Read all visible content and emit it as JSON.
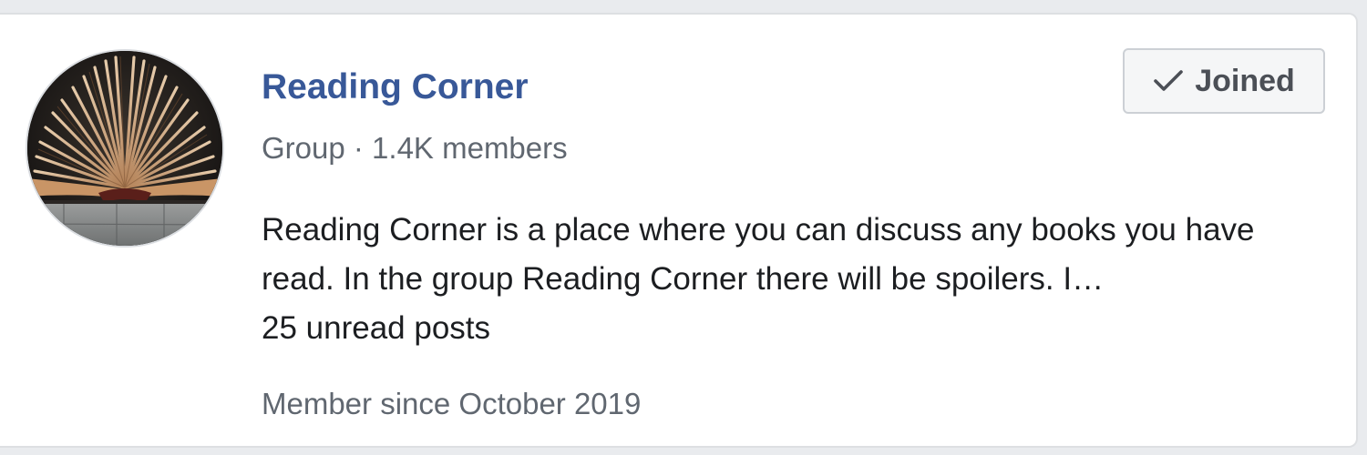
{
  "group": {
    "name": "Reading Corner",
    "meta": "Group · 1.4K members",
    "description": "Reading Corner is a place where you can discuss any books you have read. In the group Reading Corner there will be spoilers. I…",
    "unread": "25 unread posts",
    "member_since": "Member since October 2019",
    "avatar_icon": "open-book-photo"
  },
  "actions": {
    "joined_label": "Joined",
    "joined_icon": "check-icon"
  },
  "colors": {
    "link": "#385898",
    "secondary_text": "#606770",
    "primary_text": "#1c1e21",
    "button_bg": "#f5f6f7"
  }
}
